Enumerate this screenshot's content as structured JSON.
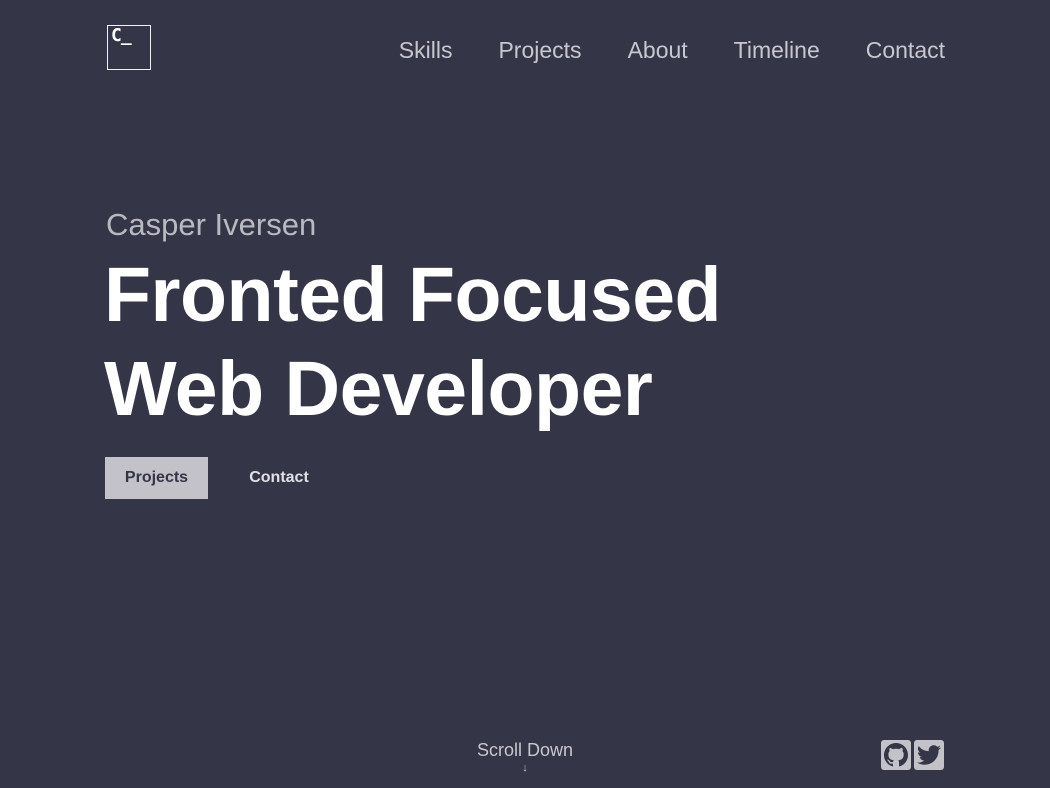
{
  "logo": {
    "text": "C_"
  },
  "nav": {
    "items": [
      {
        "label": "Skills"
      },
      {
        "label": "Projects"
      },
      {
        "label": "About"
      },
      {
        "label": "Timeline"
      },
      {
        "label": "Contact"
      }
    ]
  },
  "hero": {
    "name": "Casper Iversen",
    "title_line1": "Fronted Focused",
    "title_line2": "Web Developer",
    "primary_button": "Projects",
    "secondary_button": "Contact"
  },
  "scroll": {
    "label": "Scroll Down",
    "arrow": "↓"
  },
  "socials": [
    {
      "icon": "github-icon"
    },
    {
      "icon": "twitter-icon"
    }
  ],
  "colors": {
    "background": "#353548",
    "text_primary": "#ffffff",
    "text_muted": "#c7c7cf",
    "button_bg": "#c2c2c8"
  }
}
